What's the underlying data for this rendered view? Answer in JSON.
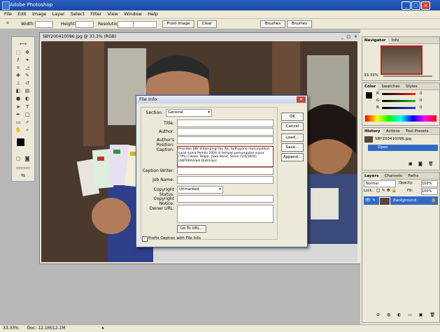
{
  "window": {
    "title": "Adobe Photoshop",
    "controls": [
      "_",
      "□",
      "×"
    ]
  },
  "menubar": [
    "File",
    "Edit",
    "Image",
    "Layer",
    "Select",
    "Filter",
    "View",
    "Window",
    "Help"
  ],
  "options": {
    "width_label": "Width:",
    "height_label": "Height:",
    "resolution_label": "Resolution:",
    "front_image": "Front Image",
    "clear": "Clear",
    "well_tabs": [
      "Brushes",
      "Brushes"
    ]
  },
  "document": {
    "title": "SBY200410096.jpg @ 33.3% (RGB)"
  },
  "navigator": {
    "tabs": [
      "Navigator",
      "Info"
    ],
    "zoom": "33.33%"
  },
  "color": {
    "tabs": [
      "Color",
      "Swatches",
      "Styles"
    ],
    "channels": [
      {
        "name": "R",
        "value": "0",
        "color": "#ff2020"
      },
      {
        "name": "G",
        "value": "0",
        "color": "#20c020"
      },
      {
        "name": "B",
        "value": "0",
        "color": "#2040ff"
      }
    ]
  },
  "history": {
    "tabs": [
      "History",
      "Actions",
      "Tool Presets"
    ],
    "snapshot": "SBY200410096.jpg",
    "step": "Open"
  },
  "layers": {
    "tabs": [
      "Layers",
      "Channels",
      "Paths"
    ],
    "blend_mode": "Normal",
    "opacity_label": "Opacity:",
    "opacity": "100%",
    "lock_label": "Lock:",
    "fill_label": "Fill:",
    "fill": "100%",
    "layer_name": "Background"
  },
  "dialog": {
    "title": "File Info",
    "section_label": "Section:",
    "section_value": "General",
    "fields": {
      "title_label": "Title:",
      "author_label": "Author:",
      "authors_position_label": "Author's Position:",
      "caption_label": "Caption:",
      "caption_text": "Presiden SBY didampingi Ibu Ani Yudhoyono menunjukkan surat suara Pemilu 2004 di tempat pemungutan suara (TPS) Cikeas, Bogor, Jawa Barat, Senin (5/4/2004). (ANTARA/Hadi Djatmiko)",
      "caption_writer_label": "Caption Writer:",
      "job_name_label": "Job Name:",
      "copyright_status_label": "Copyright Status:",
      "copyright_status_value": "Unmarked",
      "copyright_notice_label": "Copyright Notice:",
      "owner_url_label": "Owner URL:"
    },
    "goto_url": "Go To URL...",
    "prefix_checkbox": "Prefix Caption with File Info",
    "buttons": [
      "OK",
      "Cancel",
      "Load...",
      "Save...",
      "Append..."
    ]
  },
  "status": {
    "zoom": "33.33%",
    "doc": "Doc: 12.1M/12.1M"
  }
}
